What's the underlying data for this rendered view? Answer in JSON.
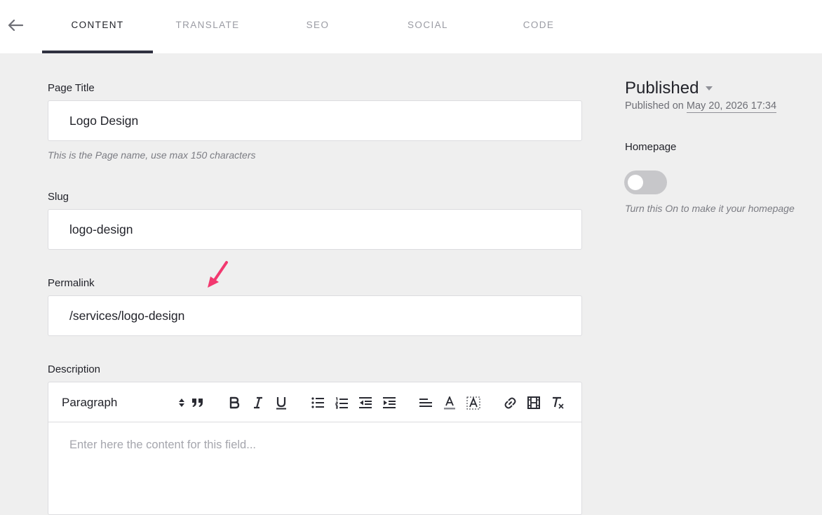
{
  "tabs": [
    {
      "label": "CONTENT",
      "active": true
    },
    {
      "label": "TRANSLATE",
      "active": false
    },
    {
      "label": "SEO",
      "active": false
    },
    {
      "label": "SOCIAL",
      "active": false
    },
    {
      "label": "CODE",
      "active": false
    }
  ],
  "form": {
    "page_title": {
      "label": "Page Title",
      "value": "Logo Design",
      "hint": "This is the Page name, use max 150 characters"
    },
    "slug": {
      "label": "Slug",
      "value": "logo-design"
    },
    "permalink": {
      "label": "Permalink",
      "value": "/services/logo-design"
    },
    "description": {
      "label": "Description",
      "format": "Paragraph",
      "placeholder": "Enter here the content for this field..."
    }
  },
  "sidebar": {
    "status": "Published",
    "published_on_label": "Published on",
    "published_date": "May 20, 2026 17:34",
    "homepage_label": "Homepage",
    "homepage_enabled": false,
    "homepage_hint": "Turn this On to make it your homepage"
  },
  "colors": {
    "accent": "#2f3140",
    "annotation_arrow": "#f2386f",
    "background": "#efefef"
  },
  "icons": {
    "back": "arrow-left-icon",
    "annotation": "pink-arrow-icon"
  }
}
